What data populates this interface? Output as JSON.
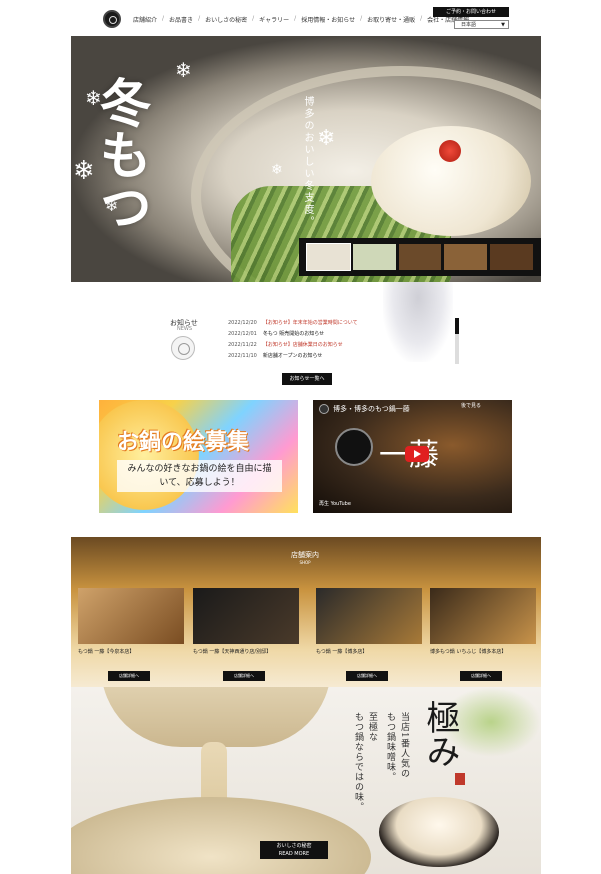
{
  "header": {
    "nav": [
      "店舗紹介",
      "お品書き",
      "おいしさの秘密",
      "ギャラリー",
      "採用情報・お知らせ",
      "お取り寄せ・通販",
      "会社・店舗情報"
    ],
    "reserve_label": "ご予約・お問い合わせ",
    "lang_selected": "日本語"
  },
  "hero": {
    "title": "冬もつ",
    "tagline": "博多のおいしい冬支度。",
    "thumb_colors": [
      "#e8e2d4",
      "#cfd8b8",
      "#6b4a2a",
      "#8a6238",
      "#5a3a20"
    ]
  },
  "news": {
    "title": "お知らせ",
    "subtitle": "NEWS",
    "items": [
      {
        "date": "2022/12/20",
        "text": "【お知らせ】年末年始の営業時間について",
        "red": true
      },
      {
        "date": "2022/12/01",
        "text": "冬もつ 販売開始のお知らせ",
        "red": false
      },
      {
        "date": "2022/11/22",
        "text": "【お知らせ】店舗休業日のお知らせ",
        "red": true
      },
      {
        "date": "2022/11/10",
        "text": "新店舗オープンのお知らせ",
        "red": false
      }
    ],
    "more_label": "お知らせ一覧へ"
  },
  "banners": {
    "contest_title": "お鍋の絵募集",
    "contest_sub": "みんなの好きなお鍋の絵を自由に描いて、応募しよう！",
    "video_title": "博多・博多のもつ鍋一藤",
    "video_watch": "後で見る",
    "video_name": "一藤",
    "video_footer": "再生 YouTube"
  },
  "shops": {
    "label": "店舗案内",
    "label_sub": "SHOP",
    "cards": [
      {
        "name": "もつ鍋 一藤【今泉本店】",
        "btn": "店舗詳細へ",
        "colors": [
          "#cfa26a",
          "#7a4d22"
        ]
      },
      {
        "name": "もつ鍋 一藤【天神西通り店/別邸】",
        "btn": "店舗詳細へ",
        "colors": [
          "#1a1a1a",
          "#4a3a2a"
        ]
      },
      {
        "name": "もつ鍋 一藤【博多店】",
        "btn": "店舗詳細へ",
        "colors": [
          "#2a2a2a",
          "#a87a38"
        ]
      },
      {
        "name": "博多もつ鍋 いちふじ【博多本店】",
        "btn": "店舗詳細へ",
        "colors": [
          "#3a2a1a",
          "#c8934a"
        ]
      }
    ]
  },
  "kiwami": {
    "heading": "極み",
    "copy_lines": [
      "当店1番人気の",
      "もつ鍋味噌味。",
      "至極な",
      "もつ鍋ならではの味。"
    ],
    "more_label": "おいしさの秘密",
    "more_sub": "READ MORE"
  }
}
